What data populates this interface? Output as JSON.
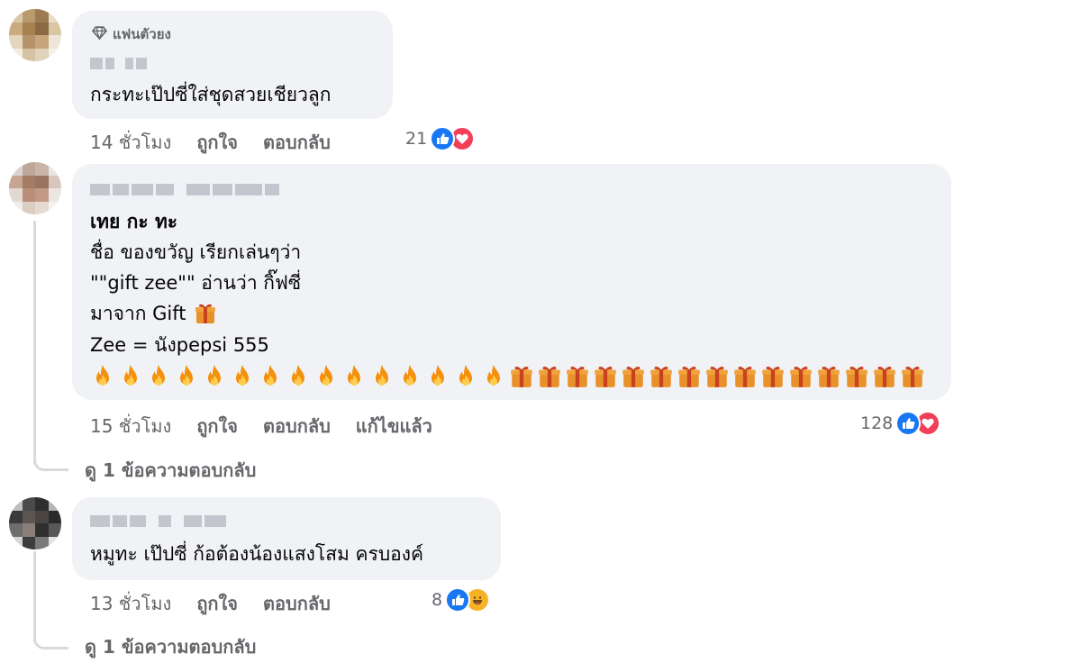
{
  "comments": [
    {
      "badge": "แฟนตัวยง",
      "lines": [
        "กระทะเป๊ปซี่ใส่ชุดสวยเชียวลูก"
      ],
      "time": "14 ชั่วโมง",
      "like_label": "ถูกใจ",
      "reply_label": "ตอบกลับ",
      "reaction_count": "21",
      "reactions": [
        "like-icon",
        "love-icon"
      ]
    },
    {
      "lines": [
        "เทย กะ ทะ",
        "ชื่อ ของขวัญ เรียกเล่นๆว่า",
        "\"\"gift zee\"\" อ่านว่า กิ๊ฟซี่",
        "มาจาก Gift",
        "Zee = นังpepsi 555"
      ],
      "fire_count": 15,
      "gift_count": 15,
      "time": "15 ชั่วโมง",
      "like_label": "ถูกใจ",
      "reply_label": "ตอบกลับ",
      "edited_label": "แก้ไขแล้ว",
      "reaction_count": "128",
      "reactions": [
        "like-icon",
        "love-icon"
      ],
      "view_replies": "ดู 1 ข้อความตอบกลับ"
    },
    {
      "lines": [
        "หมูทะ เป๊ปซี่ ก้อต้องน้องแสงโสม ครบองค์"
      ],
      "time": "13 ชั่วโมง",
      "like_label": "ถูกใจ",
      "reply_label": "ตอบกลับ",
      "reaction_count": "8",
      "reactions": [
        "like-icon",
        "haha-icon"
      ],
      "view_replies": "ดู 1 ข้อความตอบกลับ"
    }
  ],
  "colors": {
    "bubble": "#f0f2f5",
    "secondary_text": "#65676b",
    "like_blue": "#1877f2",
    "love_red": "#f33e58",
    "haha_yellow": "#f7b125"
  }
}
